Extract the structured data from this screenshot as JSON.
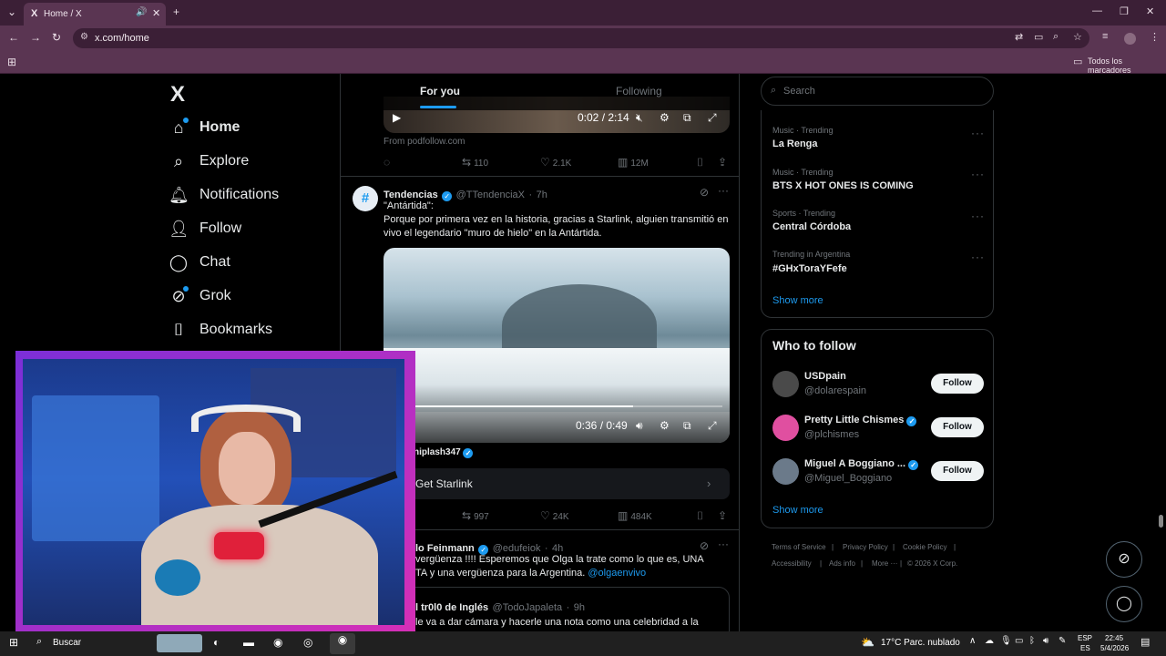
{
  "browser": {
    "tab_title": "Home / X",
    "tab_logo": "X",
    "url": "x.com/home",
    "bookmarks_folder": "Todos los marcadores"
  },
  "nav": {
    "logo": "X",
    "items": [
      {
        "label": "Home",
        "icon": "home-icon"
      },
      {
        "label": "Explore",
        "icon": "search-icon"
      },
      {
        "label": "Notifications",
        "icon": "bell-icon"
      },
      {
        "label": "Follow",
        "icon": "add-person-icon"
      },
      {
        "label": "Chat",
        "icon": "chat-bubble-icon"
      },
      {
        "label": "Grok",
        "icon": "grok-icon"
      },
      {
        "label": "Bookmarks",
        "icon": "bookmark-icon"
      }
    ]
  },
  "feed": {
    "tabs": {
      "for_you": "For you",
      "following": "Following"
    },
    "post1": {
      "video_time": "0:02 / 2:14",
      "source": "From podfollow.com",
      "retweets": "110",
      "likes": "2.1K",
      "views": "12M"
    },
    "post2": {
      "name": "Tendencias",
      "handle": "@TTendenciaX",
      "time": "7h",
      "avatar_glyph": "#",
      "text_line1": "\"Antártida\":",
      "text_line2": "Porque por primera vez en la historia, gracias a Starlink, alguien transmitió en vivo el legendario \"muro de hielo\" en la Antártida.",
      "video_time": "0:36 / 0:49",
      "video_progress": 0.73,
      "credit": "niplash347",
      "cta": "Get Starlink",
      "retweets": "997",
      "likes": "24K",
      "views": "484K"
    },
    "post3": {
      "name": "lo Feinmann",
      "handle": "@edufeiok",
      "time": "4h",
      "text_line1": "vergüenza !!!!  Esperemos que Olga la trate como lo que es, UNA",
      "text_line2_prefix": "TA y una vergüenza para la Argentina. ",
      "mention": "@olgaenvivo"
    },
    "quote": {
      "name": "l tr0l0 de Inglés",
      "handle": "@TodoJapaleta",
      "time": "9h",
      "text": "le va a dar cámara y hacerle una nota como una celebridad a la"
    }
  },
  "right": {
    "search_placeholder": "Search",
    "trends": [
      {
        "meta": "Music · Trending",
        "name": "La Renga"
      },
      {
        "meta": "Music · Trending",
        "name": "BTS X HOT ONES IS COMING"
      },
      {
        "meta": "Sports · Trending",
        "name": "Central Córdoba"
      },
      {
        "meta": "Trending in Argentina",
        "name": "#GHxToraYFefe"
      }
    ],
    "show_more": "Show more",
    "who_to_follow_title": "Who to follow",
    "who_to_follow": [
      {
        "name": "USDpain",
        "handle": "@dolarespain",
        "avatar_color": "#4a4a4a",
        "verified": false
      },
      {
        "name": "Pretty Little Chismes",
        "handle": "@plchismes",
        "avatar_color": "#e04fa0",
        "verified": true
      },
      {
        "name": "Miguel A Boggiano ...",
        "handle": "@Miguel_Boggiano",
        "avatar_color": "#6b7a8a",
        "verified": true
      }
    ],
    "follow_label": "Follow",
    "footer": [
      "Terms of Service",
      "Privacy Policy",
      "Cookie Policy",
      "Accessibility",
      "Ads info",
      "More ···",
      "© 2026 X Corp."
    ]
  },
  "taskbar": {
    "search": "Buscar",
    "weather": "17°C  Parc. nublado",
    "lang1": "ESP",
    "lang2": "ES",
    "time": "22:45",
    "date": "5/4/2026"
  },
  "colors": {
    "accent": "#1d9bf0",
    "chrome": "#5a3552",
    "chrome_dark": "#3b1f36"
  }
}
